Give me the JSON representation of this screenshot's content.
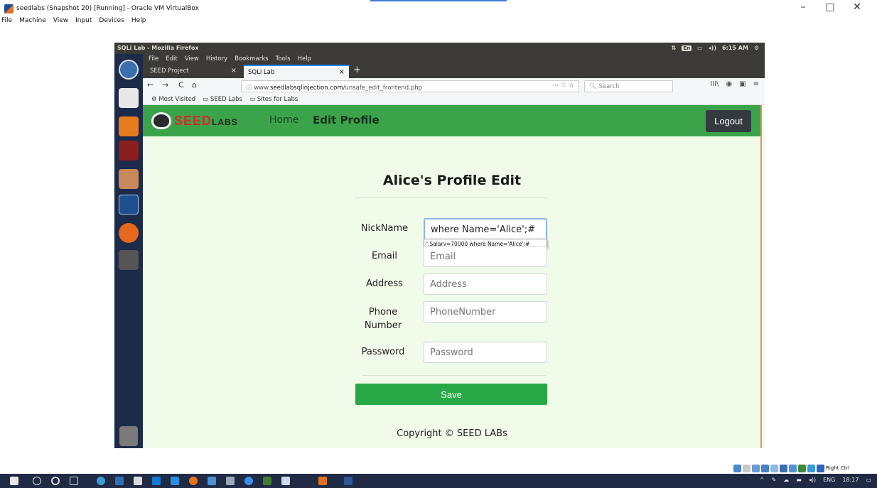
{
  "host": {
    "window_title": "seedlabs (Snapshot 20) [Running] - Oracle VM VirtualBox",
    "menu": [
      "File",
      "Machine",
      "View",
      "Input",
      "Devices",
      "Help"
    ],
    "controls": {
      "minimize": "–",
      "maximize": "□",
      "close": "✕"
    },
    "status_label": "Right Ctrl",
    "taskbar_tray": {
      "language": "ENG",
      "time": "18:17"
    }
  },
  "guest": {
    "panel_title": "SQLi Lab - Mozilla Firefox",
    "tray": {
      "badge": "En",
      "volume": "◂))",
      "time": "6:15 AM",
      "settings": "⚙"
    }
  },
  "firefox": {
    "menu": [
      "File",
      "Edit",
      "View",
      "History",
      "Bookmarks",
      "Tools",
      "Help"
    ],
    "tabs": [
      {
        "label": "SEED Project",
        "close": "×"
      },
      {
        "label": "SQLi Lab",
        "close": "×"
      }
    ],
    "new_tab": "+",
    "nav": {
      "back": "←",
      "forward": "→",
      "reload": "C",
      "home": "⌂"
    },
    "url": {
      "info": "ⓘ",
      "prefix": "www.",
      "domain": "seedlabsqlinjection.com",
      "path": "/unsafe_edit_frontend.php",
      "actions": "··· ♡ ☆"
    },
    "search_placeholder": "Search",
    "toolbar_right": [
      "III\\",
      "◉",
      "▣",
      "≡"
    ],
    "bookmarks": [
      "Most Visited",
      "SEED Labs",
      "Sites for Labs"
    ]
  },
  "webpage": {
    "logo_text": "SEED",
    "logo_sub": "LABS",
    "nav_home": "Home",
    "nav_edit": "Edit Profile",
    "logout": "Logout",
    "title": "Alice's Profile Edit",
    "fields": [
      {
        "label": "NickName",
        "value": "where Name='Alice';#",
        "placeholder": ""
      },
      {
        "label": "Email",
        "value": "",
        "placeholder": "Email"
      },
      {
        "label": "Address",
        "value": "",
        "placeholder": "Address"
      },
      {
        "label": "Phone Number",
        "value": "",
        "placeholder": "PhoneNumber"
      },
      {
        "label": "Password",
        "value": "",
        "placeholder": "Password"
      }
    ],
    "suggestion": "',Salary=70000 where Name='Alice';#",
    "save": "Save",
    "copyright": "Copyright © SEED LABs"
  }
}
